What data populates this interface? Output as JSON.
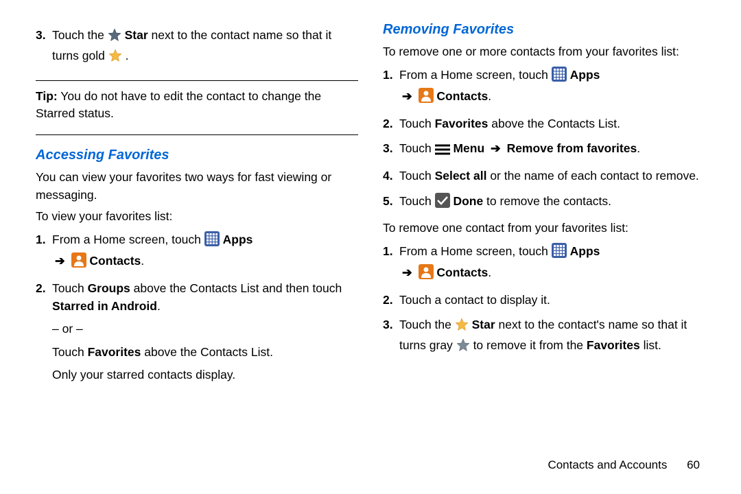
{
  "left": {
    "step3_prefix": "Touch the ",
    "step3_bold_star": "Star",
    "step3_mid": " next to the contact name so that it turns gold ",
    "step3_end": ".",
    "tip_label": "Tip:",
    "tip_text": " You do not have to edit the contact to change the Starred status.",
    "heading_access": "Accessing Favorites",
    "access_intro": "You can view your favorites two ways for fast viewing or messaging.",
    "access_toview": "To view your favorites list:",
    "step1_prefix": "From a Home screen, touch ",
    "apps_label": "Apps",
    "contacts_label": "Contacts",
    "step2_prefix": "Touch ",
    "groups_bold": "Groups",
    "step2_mid": " above the Contacts List and then touch ",
    "starred_bold": "Starred in Android",
    "step2_end": ".",
    "or_text": "– or –",
    "fav_alt_prefix": "Touch ",
    "favorites_bold": "Favorites",
    "fav_alt_end": " above the Contacts List.",
    "only_text": "Only your starred contacts display."
  },
  "right": {
    "heading_remove": "Removing Favorites",
    "remove_intro": "To remove one or more contacts from your favorites list:",
    "step1_prefix": "From a Home screen, touch ",
    "apps_label": "Apps",
    "contacts_label": "Contacts",
    "step2_prefix": "Touch ",
    "favorites_bold": "Favorites",
    "step2_end": " above the Contacts List.",
    "step3_prefix": "Touch ",
    "menu_bold": "Menu",
    "remove_bold": "Remove from favorites",
    "step3_end": ".",
    "step4_prefix": "Touch ",
    "selectall_bold": "Select all",
    "step4_end": " or the name of each contact to remove.",
    "step5_prefix": "Touch ",
    "done_bold": "Done",
    "step5_end": " to remove the contacts.",
    "remove_one_intro": "To remove one contact from your favorites list:",
    "b_step2": "Touch a contact to display it.",
    "b_step3_prefix": "Touch the ",
    "star_bold": "Star",
    "b_step3_mid": " next to the contact's name so that it turns gray ",
    "b_step3_mid2": " to remove it from the ",
    "fav_list_bold": "Favorites",
    "b_step3_end": " list."
  },
  "footer": {
    "section": "Contacts and Accounts",
    "page": "60"
  },
  "nums": {
    "n1": "1.",
    "n2": "2.",
    "n3": "3.",
    "n4": "4.",
    "n5": "5."
  },
  "arrow": "➔"
}
